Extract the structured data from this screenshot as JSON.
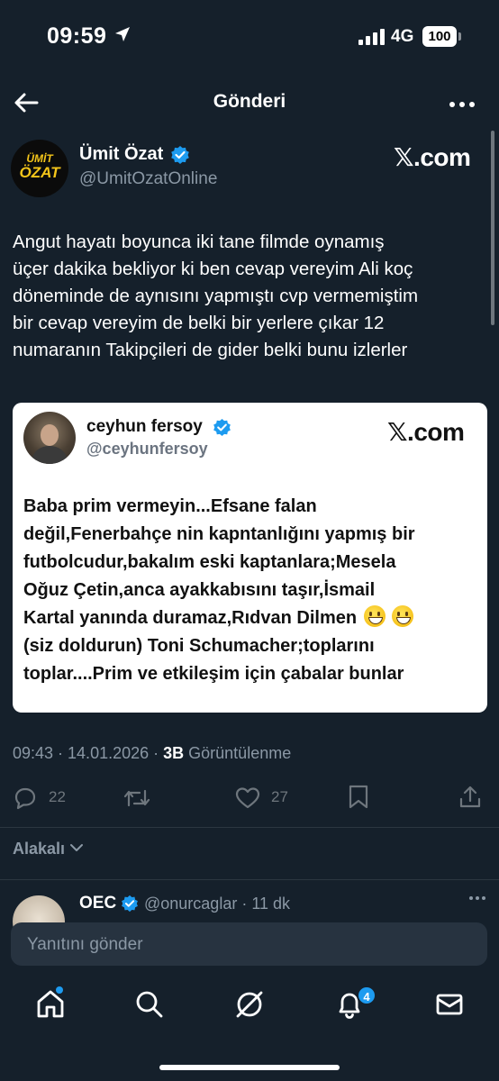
{
  "status_bar": {
    "time": "09:59",
    "network": "4G",
    "battery": "100"
  },
  "header": {
    "title": "Gönderi"
  },
  "post": {
    "avatar_line1": "ÜMİT",
    "avatar_line2": "ÖZAT",
    "author_name": "Ümit Özat",
    "author_handle": "@UmitOzatOnline",
    "source_label": "𝕏.com",
    "text_lines": [
      "Angut hayatı boyunca iki tane filmde oynamış",
      "üçer dakika bekliyor ki ben cevap vereyim Ali koç",
      "döneminde de aynısını yapmıştı cvp vermemiştim",
      "bir cevap vereyim de belki bir yerlere çıkar 12",
      "numaranın  Takipçileri de gider belki bunu izlerler"
    ],
    "timestamp": "09:43 · 14.01.2026 · ",
    "views_count": "3B",
    "views_label": "Görüntülenme"
  },
  "quoted": {
    "author_name": "ceyhun fersoy",
    "author_handle": "@ceyhunfersoy",
    "source_label": "𝕏.com",
    "text_lines": [
      "Baba prim vermeyin...Efsane falan",
      "değil,Fenerbahçe nin kapntanlığını yapmış bir",
      "futbolcudur,bakalım eski kaptanlara;Mesela",
      "Oğuz Çetin,anca ayakkabısını taşır,İsmail",
      "Kartal yanında duramaz,Rıdvan Dilmen",
      "(siz doldurun) Toni Schumacher;toplarını",
      "toplar....Prim ve etkileşim için çabalar bunlar"
    ]
  },
  "actions": {
    "replies": "22",
    "likes": "27"
  },
  "related": {
    "label": "Alakalı"
  },
  "reply": {
    "author_name": "OEC",
    "author_handle": "@onurcaglar · 11 dk"
  },
  "composer": {
    "placeholder": "Yanıtını gönder"
  },
  "tabbar": {
    "notifications_badge": "4"
  },
  "colors": {
    "background": "#15202b",
    "accent": "#1d9bf0",
    "muted": "#8b98a5"
  }
}
